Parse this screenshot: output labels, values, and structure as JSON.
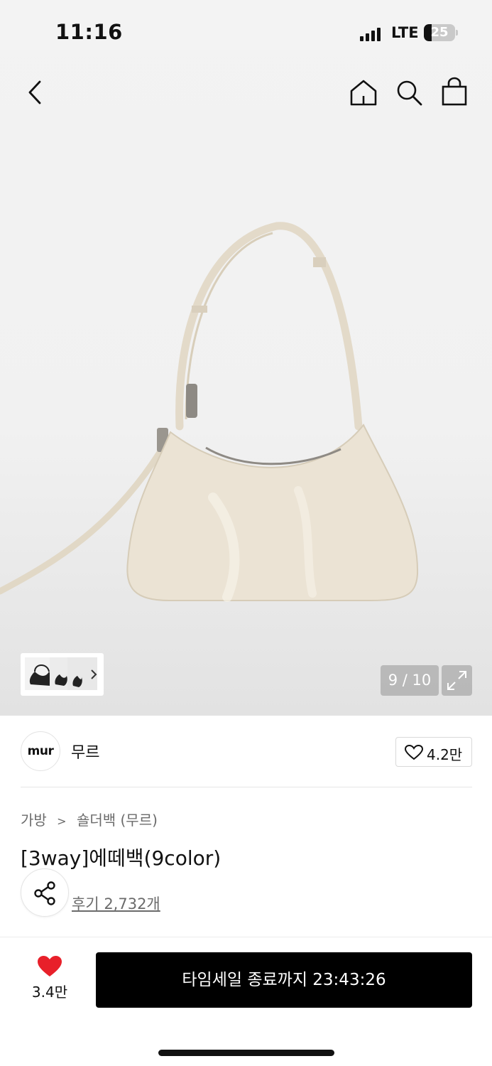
{
  "status_bar": {
    "time": "11:16",
    "network": "LTE",
    "battery": "25",
    "battery_level": 0.25
  },
  "header": {
    "icons": [
      "back-arrow-icon",
      "home-icon",
      "search-icon",
      "shopping-bag-icon"
    ]
  },
  "gallery": {
    "counter": "9 / 10",
    "thumb_count": 3
  },
  "brand": {
    "logo_text": "mur",
    "name": "무르",
    "likes": "4.2만"
  },
  "breadcrumb": {
    "category": "가방",
    "separator": ">",
    "subcategory": "숄더백 (무르)"
  },
  "product": {
    "title": "[3way]에떼백(9color)",
    "reviews": "후기 2,732개"
  },
  "bottom_bar": {
    "wish_count": "3.4만",
    "cta_label": "타임세일 종료까지 23:43:26"
  },
  "colors": {
    "accent_red": "#e8202a",
    "cta_bg": "#000000",
    "bag_cream": "#ebe3d4"
  }
}
